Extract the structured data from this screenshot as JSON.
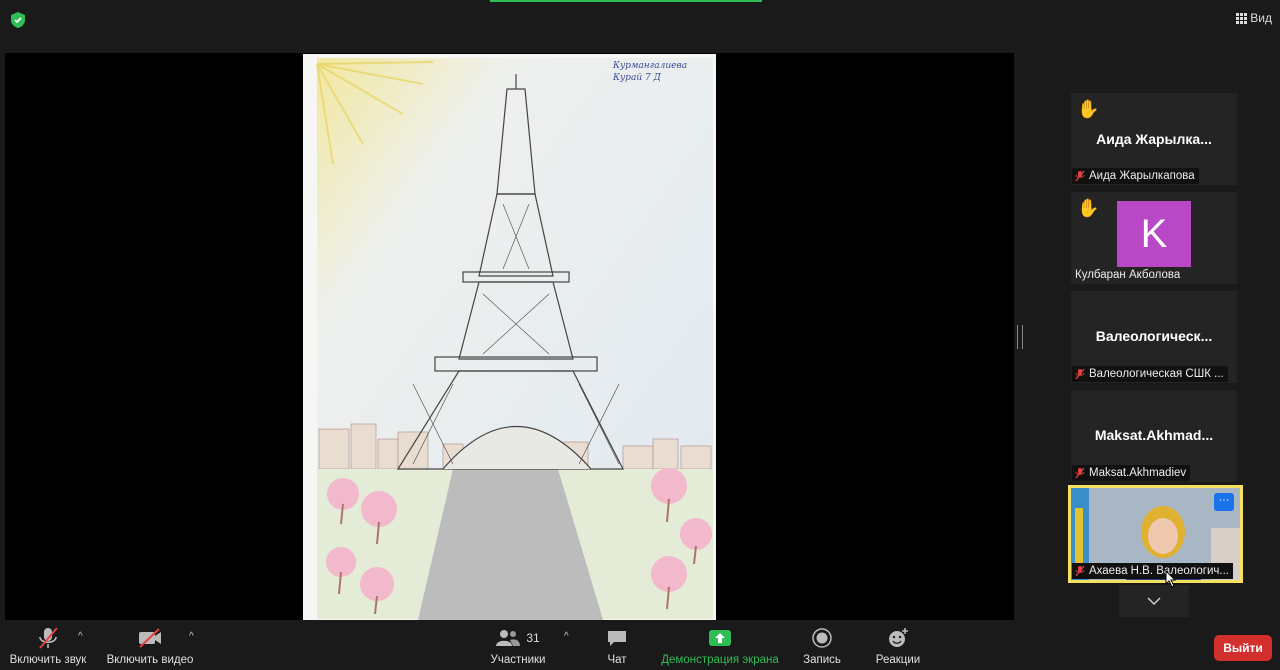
{
  "topbar": {
    "view_label": "Вид"
  },
  "shared_screen": {
    "signature": "Курмангалиева Курай 7 Д"
  },
  "participants": [
    {
      "display": "Аида  Жарылка...",
      "name": "Аида Жарылкапова",
      "hand_raised": true
    },
    {
      "avatar_letter": "K",
      "name": "Кулбаран Акболова",
      "hand_raised": true
    },
    {
      "display": "Валеологическ...",
      "name": "Валеологическая СШК ..."
    },
    {
      "display": "Maksat.Akhmad...",
      "name": "Maksat.Akhmadiev"
    },
    {
      "name": "Ахаева Н.В. Валеологич...",
      "more_label": "···"
    }
  ],
  "toolbar": {
    "unmute": "Включить звук",
    "start_video": "Включить видео",
    "participants": "Участники",
    "participants_count": "31",
    "chat": "Чат",
    "share_screen": "Демонстрация экрана",
    "record": "Запись",
    "reactions": "Реакции",
    "leave": "Выйти"
  },
  "colors": {
    "accent_green": "#2fbd56",
    "leave_red": "#d32f2f",
    "active_border": "#f4e15f",
    "avatar_purple": "#b848c6",
    "more_blue": "#1a73e8"
  }
}
